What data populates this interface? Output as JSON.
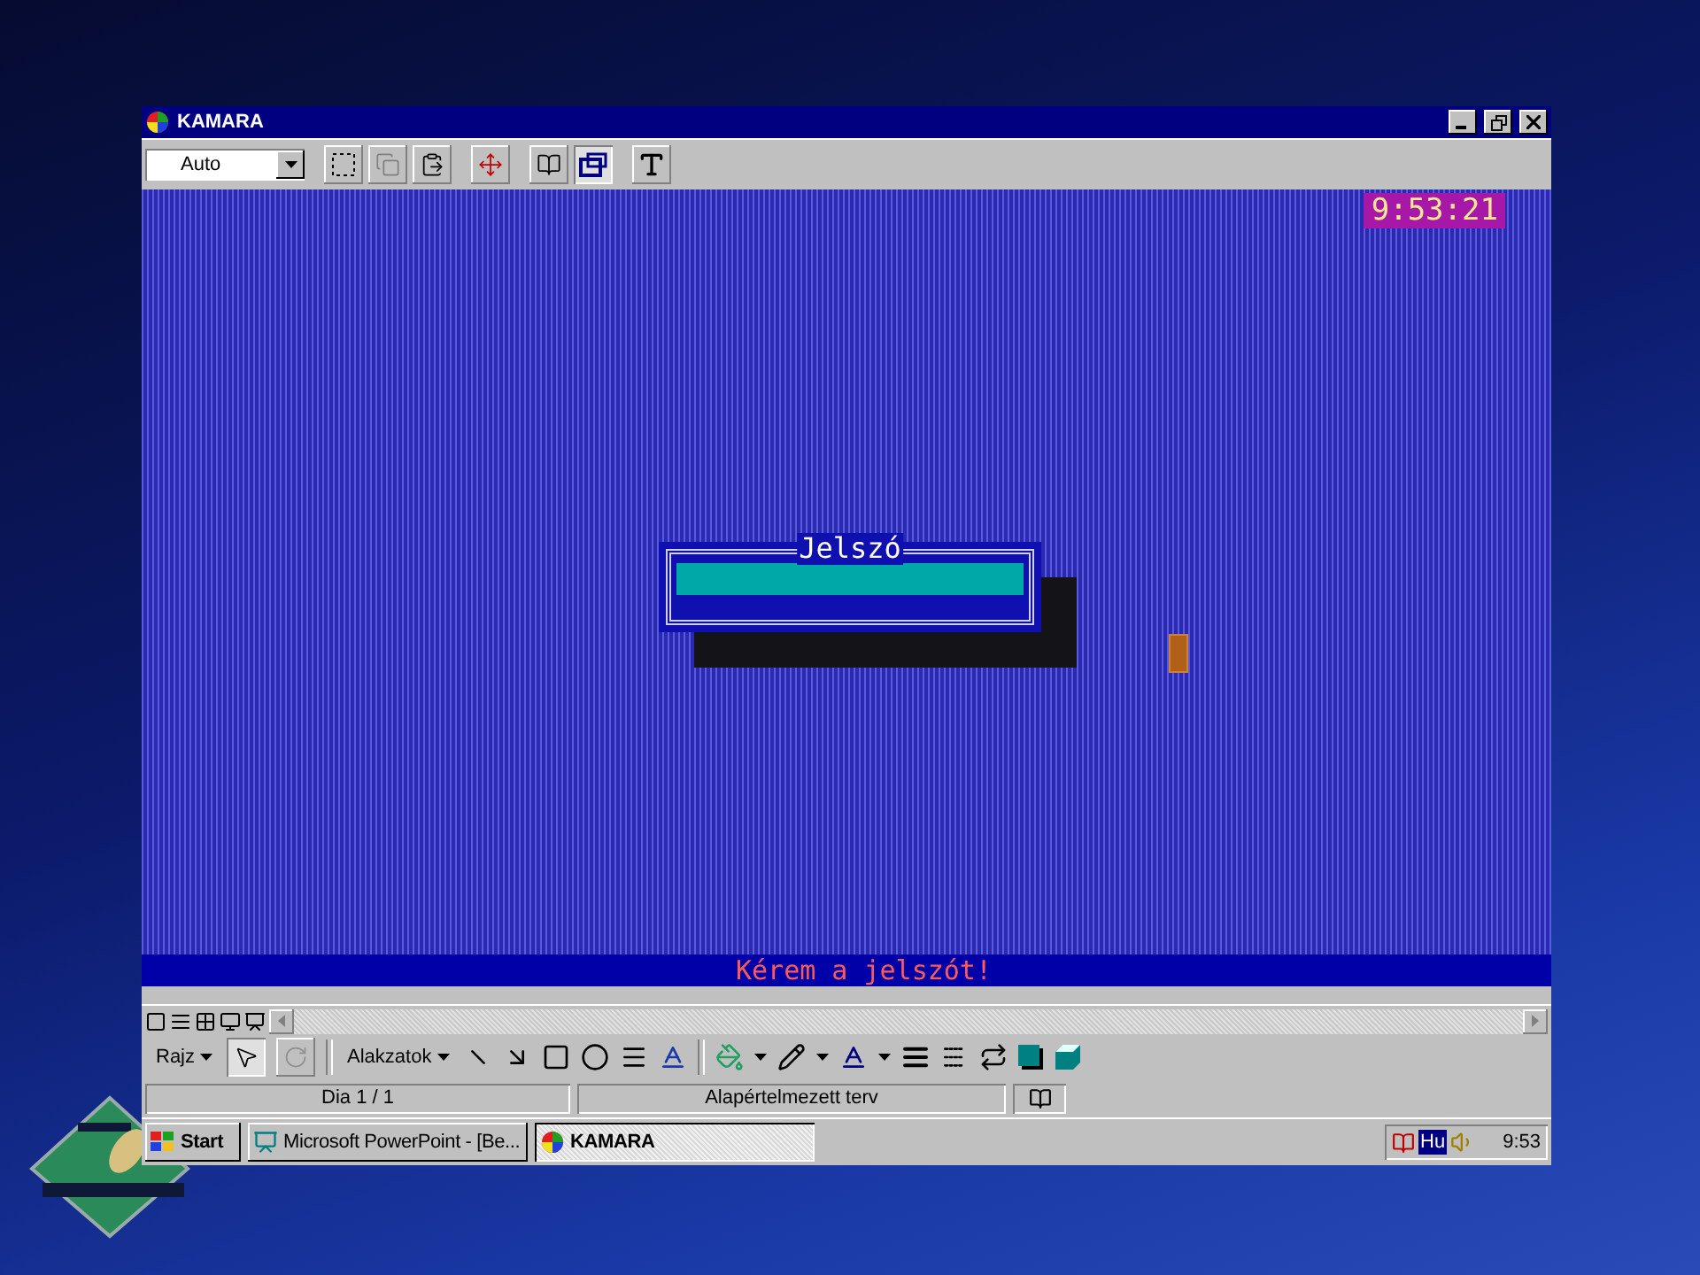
{
  "window": {
    "title": "KAMARA"
  },
  "toolbar": {
    "dropdown": {
      "value": "Auto"
    },
    "buttons": [
      {
        "kind": "select",
        "pressed": false
      },
      {
        "kind": "copy",
        "pressed": false
      },
      {
        "kind": "paste",
        "pressed": false
      },
      {
        "kind": "move",
        "pressed": false
      },
      {
        "kind": "properties",
        "pressed": false
      },
      {
        "kind": "window",
        "pressed": true
      },
      {
        "kind": "font",
        "pressed": false
      }
    ]
  },
  "screen": {
    "clock": "9:53:21",
    "dialog": {
      "title": "Jelszó"
    },
    "prompt": "Kérem a jelszót!"
  },
  "drawing_toolbar": {
    "menu": "Rajz",
    "shapes_menu": "Alakzatok",
    "tools": [
      {
        "kind": "pointer",
        "selected": true
      },
      {
        "kind": "rotate",
        "selected": false
      }
    ]
  },
  "status_bar": {
    "slide": "Dia 1 / 1",
    "design": "Alapértelmezett terv"
  },
  "taskbar": {
    "start": "Start",
    "tasks": [
      {
        "label": "Microsoft PowerPoint - [Be...",
        "kind": "powerpoint",
        "selected": false
      },
      {
        "label": "KAMARA",
        "kind": "kamara",
        "selected": true
      }
    ],
    "language": "Hu",
    "time": "9:53"
  }
}
